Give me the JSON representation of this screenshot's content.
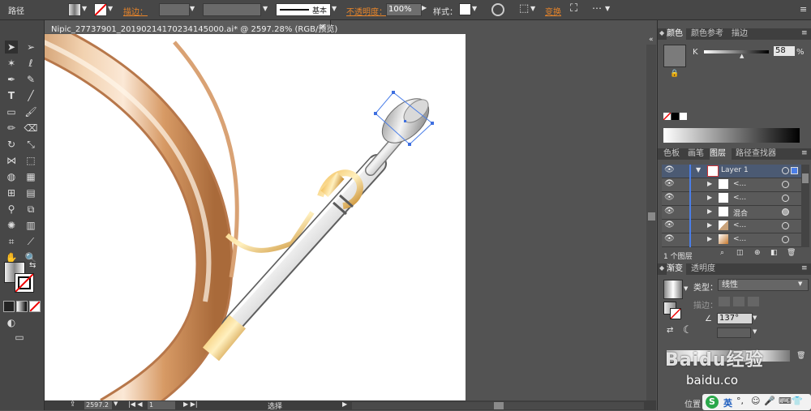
{
  "control_bar": {
    "selection_label": "路径",
    "stroke_label": "描边：",
    "brush_label": "基本",
    "opacity_label": "不透明度：",
    "opacity_value": "100%",
    "style_label": "样式：",
    "transform_label": "变换"
  },
  "document": {
    "tab_title": "Nipic_27737901_20190214170234145000.ai* @ 2597.28% (RGB/预览)",
    "close_glyph": "×"
  },
  "color_panel": {
    "tabs": [
      "颜色",
      "颜色参考",
      "描边"
    ],
    "channel_label": "K",
    "channel_value": "58",
    "unit": "%"
  },
  "layers_panel": {
    "tabs": [
      "色板",
      "画笔",
      "图层",
      "路径查找器"
    ],
    "rows": [
      {
        "name": "Layer 1",
        "expanded": true,
        "indent": 0
      },
      {
        "name": "<...",
        "expanded": false,
        "indent": 1
      },
      {
        "name": "<...",
        "expanded": false,
        "indent": 1
      },
      {
        "name": "混合",
        "expanded": false,
        "indent": 1
      },
      {
        "name": "<...",
        "expanded": false,
        "indent": 1
      },
      {
        "name": "<...",
        "expanded": false,
        "indent": 1
      }
    ],
    "footer_count": "1 个图层"
  },
  "gradient_panel": {
    "tabs": [
      "渐变",
      "透明度"
    ],
    "type_label": "类型：",
    "type_value": "线性",
    "stroke_label": "描边：",
    "angle_value": "137°"
  },
  "status_bar": {
    "zoom_value": "2597.2",
    "artboard_value": "1",
    "tool_label": "选择"
  },
  "watermark": {
    "brand": "Baidu经验",
    "url": "baidu.co",
    "position_label": "位置",
    "ime_label": "英"
  },
  "colors": {
    "accent": "#e8852a",
    "panel_bg": "#535353",
    "artboard": "#ffffff"
  }
}
